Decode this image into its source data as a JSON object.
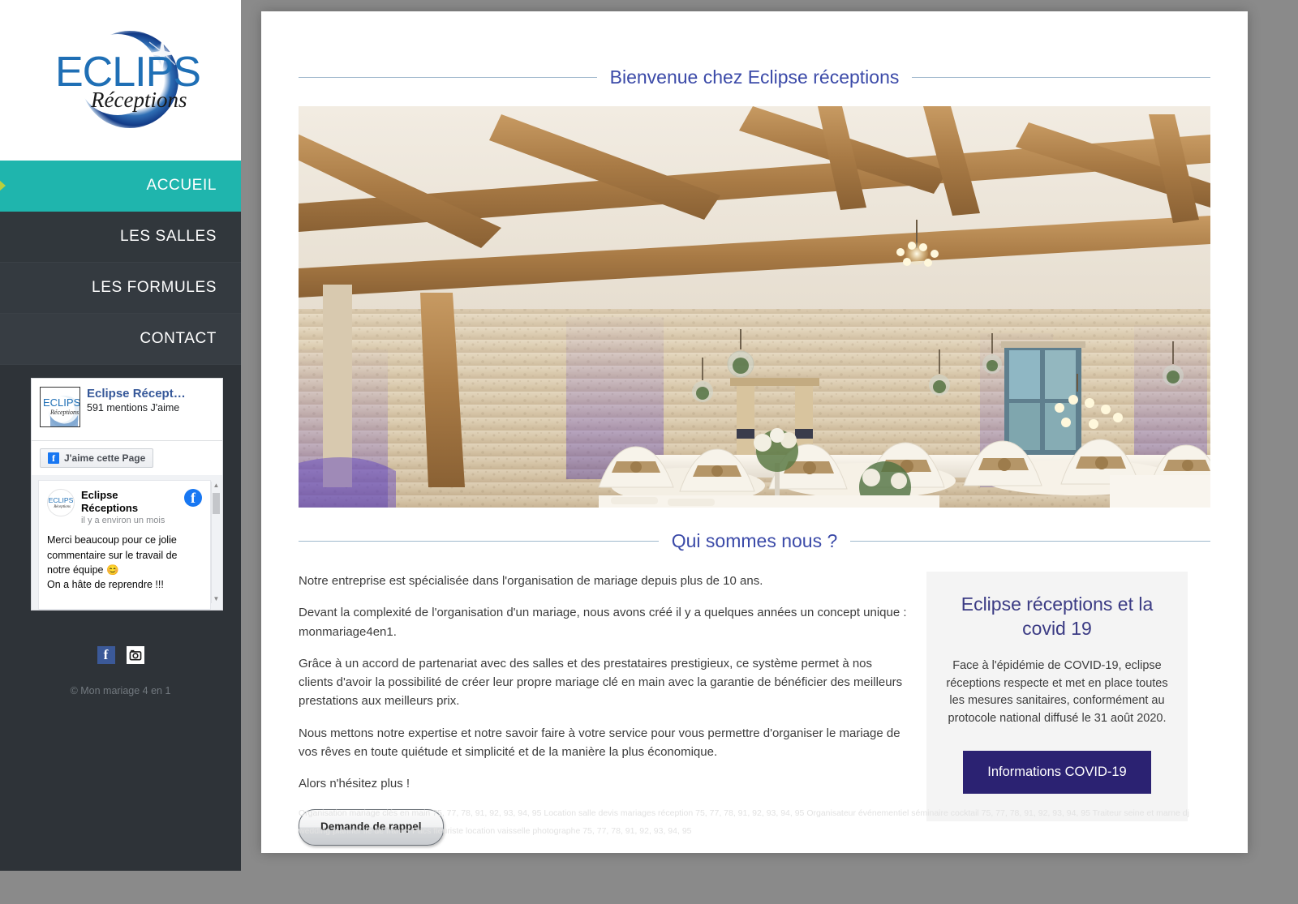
{
  "brand": {
    "logo_main": "ECLIPSE",
    "logo_script": "Réceptions"
  },
  "sidebar": {
    "nav": [
      {
        "label": "ACCUEIL",
        "active": true
      },
      {
        "label": "LES SALLES",
        "active": false
      },
      {
        "label": "LES FORMULES",
        "active": false
      },
      {
        "label": "CONTACT",
        "active": false
      }
    ],
    "facebook_widget": {
      "page_name": "Eclipse Récept…",
      "likes": "591 mentions J'aime",
      "like_button": "J'aime cette Page",
      "post": {
        "author": "Eclipse Réceptions",
        "time": "il y a environ un mois",
        "text": "Merci beaucoup pour ce jolie commentaire sur le travail de notre équipe 😊\nOn a hâte de reprendre !!!"
      }
    },
    "social": {
      "facebook": "f",
      "instagram": "instagram-icon"
    },
    "copyright": "© Mon mariage 4 en 1"
  },
  "main": {
    "welcome_title": "Bienvenue chez Eclipse réceptions",
    "hero_alt": "Salle de réception en grange avec tables dressées",
    "about_title": "Qui sommes nous ?",
    "paragraphs": [
      "Notre entreprise est spécialisée dans l'organisation de mariage depuis plus de 10 ans.",
      "Devant la complexité de l'organisation d'un mariage, nous avons créé il y a quelques années un concept unique : monmariage4en1.",
      "Grâce à un accord de partenariat avec des salles et des prestataires prestigieux, ce système permet à nos clients d'avoir la possibilité de créer leur propre mariage clé en main avec la garantie de bénéficier des meilleurs prestations aux meilleurs prix.",
      "Nous mettons notre expertise et notre savoir faire à votre service pour vous permettre d'organiser le mariage de vos rêves en toute quiétude et simplicité et de la manière la plus économique.",
      "Alors n'hésitez plus !"
    ],
    "callback_button": "Demande de rappel",
    "covid": {
      "title": "Eclipse réceptions et la covid 19",
      "text": "Face à l'épidémie de COVID-19, eclipse réceptions respecte et met en place toutes les mesures sanitaires, conformément au protocole national diffusé le 31 août 2020.",
      "button": "Informations COVID-19"
    },
    "seo_text": "Organisation mariage clés en main 75, 77, 78, 91, 92, 93, 94, 95 Location salle devis mariages réception 75, 77, 78, 91, 92, 93, 94, 95 Organisateur événementiel séminaire cocktail 75, 77, 78, 91, 92, 93, 94, 95 Traiteur seine et marne dj wedding planner ile de france Pacs fleuriste location vaisselle photographe 75, 77, 78, 91, 92, 93, 94, 95"
  },
  "colors": {
    "accent_teal": "#1fb5ad",
    "sidebar_dark": "#2e3338",
    "heading_blue": "#3b4aa8",
    "covid_navy": "#2b2272",
    "facebook_blue": "#1877f2"
  }
}
